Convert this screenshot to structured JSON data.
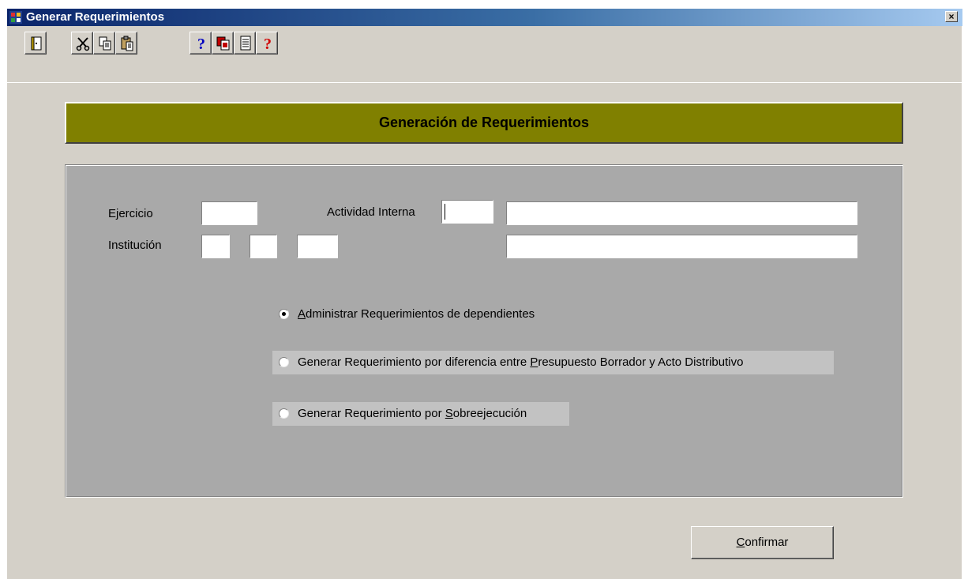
{
  "window": {
    "title": "Generar Requerimientos",
    "close_label": "×"
  },
  "toolbar": {
    "buttons": [
      {
        "icon": "exit-door-icon",
        "label": ""
      },
      {
        "icon": "scissors-cut-icon",
        "label": ""
      },
      {
        "icon": "copy-icon",
        "label": ""
      },
      {
        "icon": "paste-icon",
        "label": ""
      },
      {
        "icon": "help-icon",
        "label": ""
      },
      {
        "icon": "copy-red-icon",
        "label": ""
      },
      {
        "icon": "document-icon",
        "label": ""
      },
      {
        "icon": "red-help-icon",
        "label": ""
      }
    ]
  },
  "header": {
    "title": "Generación de Requerimientos",
    "color": "#808000"
  },
  "form": {
    "ejercicio_label": "Ejercicio",
    "institucion_label": "Institución",
    "actividad_label": "Actividad Interna",
    "ejercicio_value": "",
    "institucion_1": "",
    "institucion_2": "",
    "institucion_3": "",
    "actividad_code": "",
    "actividad_desc": "",
    "institucion_desc": ""
  },
  "options": {
    "selected": 0,
    "items": [
      {
        "pre": "",
        "accel": "A",
        "post": "dministrar Requerimientos de dependientes"
      },
      {
        "pre": "Generar Requerimiento por diferencia entre ",
        "accel": "P",
        "post": "resupuesto Borrador y Acto Distributivo"
      },
      {
        "pre": "Generar Requerimiento por ",
        "accel": "S",
        "post": "obreejecución"
      }
    ]
  },
  "actions": {
    "confirm_accel": "C",
    "confirm_rest": "onfirmar"
  }
}
